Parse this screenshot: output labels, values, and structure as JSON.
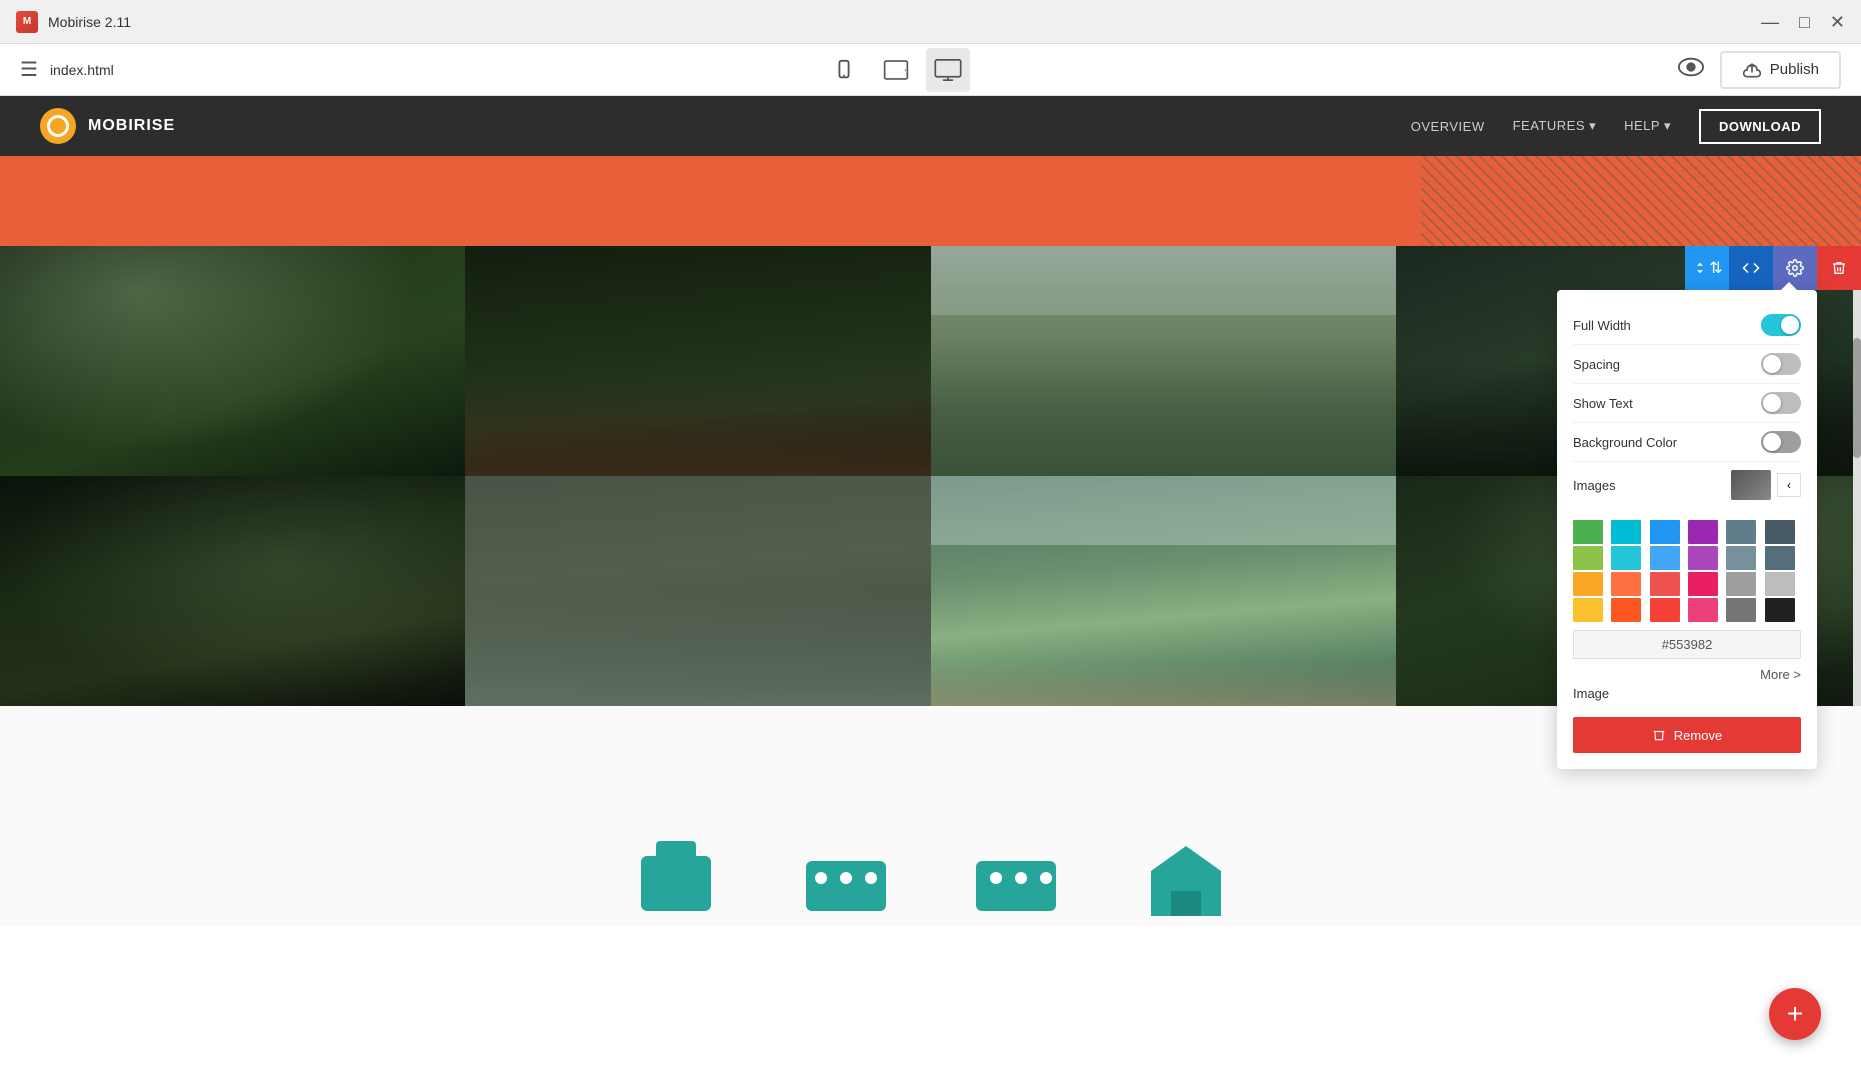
{
  "titleBar": {
    "appName": "Mobirise 2.11",
    "logoText": "M",
    "minimizeIcon": "—",
    "maximizeIcon": "□",
    "closeIcon": "✕"
  },
  "toolbar": {
    "hamburgerIcon": "☰",
    "fileName": "index.html",
    "deviceMobile": "📱",
    "deviceTablet": "⬜",
    "deviceDesktop": "🖥",
    "previewIcon": "👁",
    "publishLabel": "Publish",
    "publishIcon": "☁"
  },
  "siteNav": {
    "brand": "MOBIRISE",
    "links": [
      "OVERVIEW",
      "FEATURES ▾",
      "HELP ▾"
    ],
    "downloadLabel": "DOWNLOAD"
  },
  "settingsPanel": {
    "title": "Settings",
    "rows": [
      {
        "label": "Full Width",
        "toggleState": "on"
      },
      {
        "label": "Spacing",
        "toggleState": "off"
      },
      {
        "label": "Show Text",
        "toggleState": "off"
      },
      {
        "label": "Background Color",
        "toggleState": "off"
      }
    ],
    "imagesLabel": "Images",
    "imageLabel": "Image",
    "moreLabel": "More >",
    "removeLabel": "Remove",
    "hexValue": "#553982",
    "colors": [
      "#4caf50",
      "#00bcd4",
      "#2196f3",
      "#9c27b0",
      "#607d8b",
      "#455a64",
      "#8bc34a",
      "#26c6da",
      "#42a5f5",
      "#ab47bc",
      "#78909c",
      "#546e7a",
      "#f9a825",
      "#ff7043",
      "#ef5350",
      "#e91e63",
      "#9e9e9e",
      "#bdbdbd",
      "#fbc02d",
      "#ff5722",
      "#f44336",
      "#ec407a",
      "#757575",
      "#212121"
    ]
  },
  "fab": {
    "icon": "+"
  }
}
